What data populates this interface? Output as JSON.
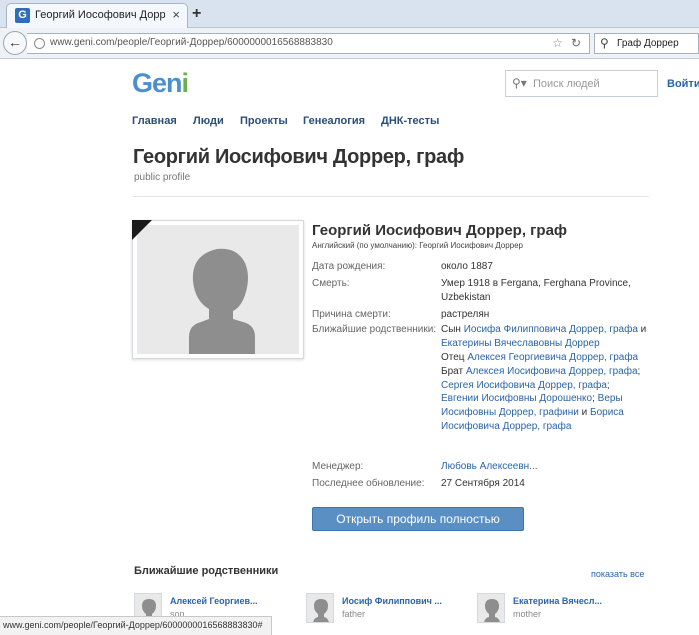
{
  "browser": {
    "tab_title": "Георгий Иософович Доррер...",
    "tab_favicon": "G",
    "tab_close": "×",
    "new_tab": "+",
    "url": "www.geni.com/people/Георгий-Доррер/6000000016568883830",
    "search_value": "Граф Доррер",
    "status_url": "www.geni.com/people/Георгий-Доррер/6000000016568883830#"
  },
  "site": {
    "logo_part1": "Gen",
    "logo_part2": "i",
    "search_placeholder": "Поиск людей",
    "login": "Войти",
    "nav": [
      "Главная",
      "Люди",
      "Проекты",
      "Генеалогия",
      "ДНК-тесты"
    ]
  },
  "profile": {
    "title": "Георгий Иосифович Доррер, граф",
    "subtitle": "public profile",
    "name": "Георгий Иосифович Доррер, граф",
    "name_english": "Английский (по умолчанию): Георгий Иосифович Доррер",
    "fields": {
      "birth_label": "Дата рождения:",
      "birth_value": "около 1887",
      "death_label": "Смерть:",
      "death_value_1": "Умер 1918 в Fergana, Ferghana Province,",
      "death_value_2": "Uzbekistan",
      "cause_label": "Причина смерти:",
      "cause_value": "растрелян",
      "relatives_label": "Ближайшие родственники:",
      "manager_label": "Менеджер:",
      "manager_value": "Любовь Алексеевн...",
      "updated_label": "Последнее обновление:",
      "updated_value": "27 Сентября 2014"
    },
    "relatives_text": {
      "son_prefix": "Сын ",
      "father_link": "Иосифа Филипповича Доррер, графа",
      "and1": " и",
      "mother_link": "Екатерины Вячеславовны Доррер",
      "father_prefix": "Отец ",
      "son_link": "Алексея Георгиевича Доррер, графа",
      "brother_prefix": "Брат ",
      "brother1_link": "Алексея Иосифовича Доррер, графа",
      "sep1": ";",
      "brother2_link": "Сергея Иосифовича Доррер, графа",
      "sep2": ";",
      "sister1_link": "Евгении Иосифовны Дорошенко",
      "sep3": "; ",
      "sister2_link_a": "Веры",
      "sister2_link_b": "Иосифовны Доррер, графини",
      "and2": " и ",
      "brother3_link_a": "Бориса",
      "brother3_link_b": "Иосифовича Доррер, графа"
    },
    "open_button": "Открыть профиль полностью"
  },
  "relatives": {
    "title": "Ближайшие родственники",
    "show_all": "показать все",
    "cards": [
      {
        "name": "Алексей Георгиев...",
        "role": "son"
      },
      {
        "name": "Иосиф Филиппович ...",
        "role": "father"
      },
      {
        "name": "Екатерина Вячесл...",
        "role": "mother"
      }
    ]
  },
  "colors": {
    "link": "#2a64a8",
    "button": "#5a8fc4",
    "logo_blue": "#4a8fcf",
    "logo_green": "#6ab04c"
  },
  "icons": [
    "geni-favicon-icon",
    "close-icon",
    "new-tab-icon",
    "back-arrow-icon",
    "globe-icon",
    "star-icon",
    "reload-icon",
    "search-icon",
    "silhouette-icon",
    "mourning-ribbon-icon"
  ]
}
